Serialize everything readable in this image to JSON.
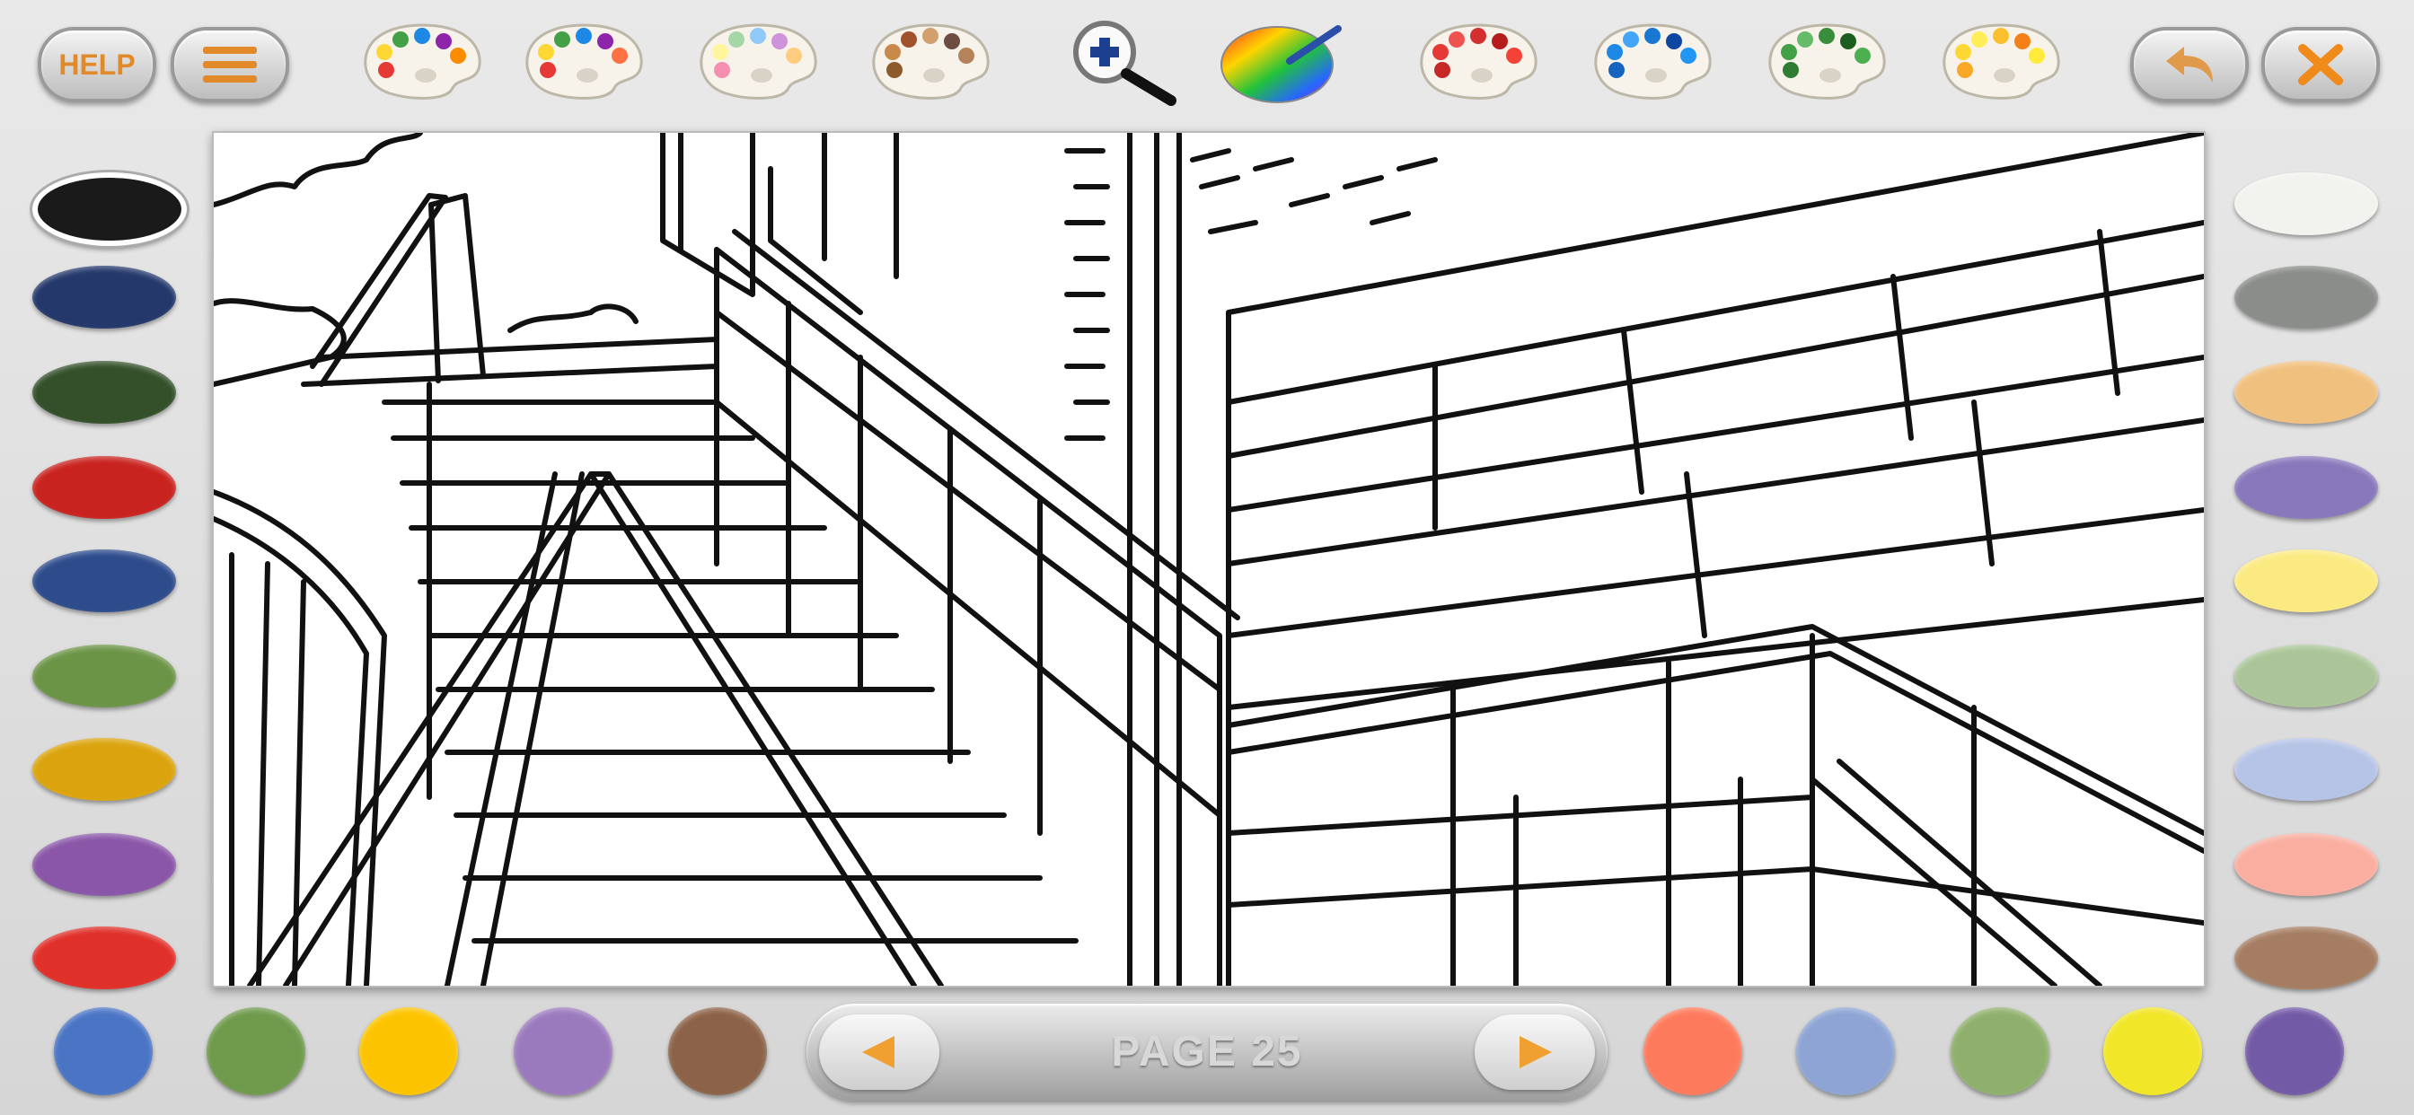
{
  "toolbar": {
    "help_label": "HELP",
    "page_label": "PAGE 25"
  },
  "icons": {
    "menu": "menu-icon",
    "zoom": "zoom-in-icon",
    "color_wheel": "color-wheel-icon",
    "undo": "undo-icon",
    "close": "close-icon",
    "prev": "previous-page-icon",
    "next": "next-page-icon"
  },
  "palettes": [
    {
      "name": "palette-classic",
      "dots": [
        "#e53935",
        "#fdd835",
        "#43a047",
        "#1e88e5",
        "#8e24aa",
        "#fb8c00"
      ]
    },
    {
      "name": "palette-bright",
      "dots": [
        "#e53935",
        "#fdd835",
        "#43a047",
        "#1e88e5",
        "#8e24aa",
        "#ff7043"
      ]
    },
    {
      "name": "palette-pastel",
      "dots": [
        "#f48fb1",
        "#fff59d",
        "#a5d6a7",
        "#90caf9",
        "#ce93d8",
        "#ffcc80"
      ]
    },
    {
      "name": "palette-earth",
      "dots": [
        "#8d5a2b",
        "#c8894a",
        "#a0522d",
        "#d2a06d",
        "#6d4c41",
        "#b5835a"
      ]
    },
    {
      "name": "palette-reds",
      "dots": [
        "#c62828",
        "#e53935",
        "#ef5350",
        "#d32f2f",
        "#b71c1c",
        "#f44336"
      ]
    },
    {
      "name": "palette-blues",
      "dots": [
        "#1565c0",
        "#1e88e5",
        "#42a5f5",
        "#1976d2",
        "#0d47a1",
        "#2196f3"
      ]
    },
    {
      "name": "palette-greens",
      "dots": [
        "#2e7d32",
        "#43a047",
        "#66bb6a",
        "#388e3c",
        "#1b5e20",
        "#4caf50"
      ]
    },
    {
      "name": "palette-yellows",
      "dots": [
        "#f9a825",
        "#fdd835",
        "#ffee58",
        "#fbc02d",
        "#f57f17",
        "#ffeb3b"
      ]
    }
  ],
  "left_swatches": [
    "#1a1a1a",
    "#24386b",
    "#33502a",
    "#c9231f",
    "#2e4c8c",
    "#6b9446",
    "#dba40e",
    "#8a56a8",
    "#e0302a"
  ],
  "right_swatches": [
    "#f2f2ee",
    "#8a8d89",
    "#f0c07e",
    "#8877bb",
    "#fbea82",
    "#abc598",
    "#b5c3e6",
    "#f9aea0",
    "#a57d62"
  ],
  "bottom_left_swatches": [
    "#4a74c4",
    "#6f9a4c",
    "#fcc400",
    "#9b79bd",
    "#8c6348"
  ],
  "bottom_right_swatches": [
    "#fe7a5c",
    "#8da4d4",
    "#8fb06c",
    "#f1e627",
    "#735aa6"
  ]
}
